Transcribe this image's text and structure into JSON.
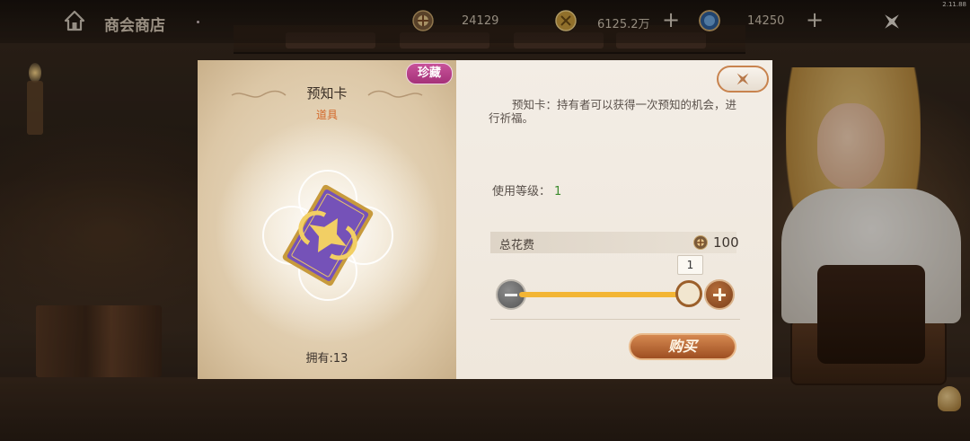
{
  "topbar": {
    "title": "商会商店",
    "version": "2.11.88",
    "resources": [
      {
        "icon": "guild-coin-icon",
        "value": "24129"
      },
      {
        "icon": "gold-coin-icon",
        "value": "6125.2万"
      },
      {
        "icon": "blue-gem-icon",
        "value": "14250"
      }
    ]
  },
  "item": {
    "rarity_badge": "珍藏",
    "name": "预知卡",
    "type": "道具",
    "owned": "拥有:13",
    "description": "预知卡：持有者可以获得一次预知的机会，进行祈福。",
    "level_label": "使用等级：",
    "level_value": "1"
  },
  "purchase": {
    "cost_label": "总花费",
    "cost_value": "100",
    "quantity": "1",
    "buy_label": "购买"
  },
  "colors": {
    "accent": "#c8834e",
    "slider": "#f3b534",
    "rare_badge": "#b83f89",
    "type_text": "#d3682a",
    "level_text": "#3b8a2d"
  }
}
